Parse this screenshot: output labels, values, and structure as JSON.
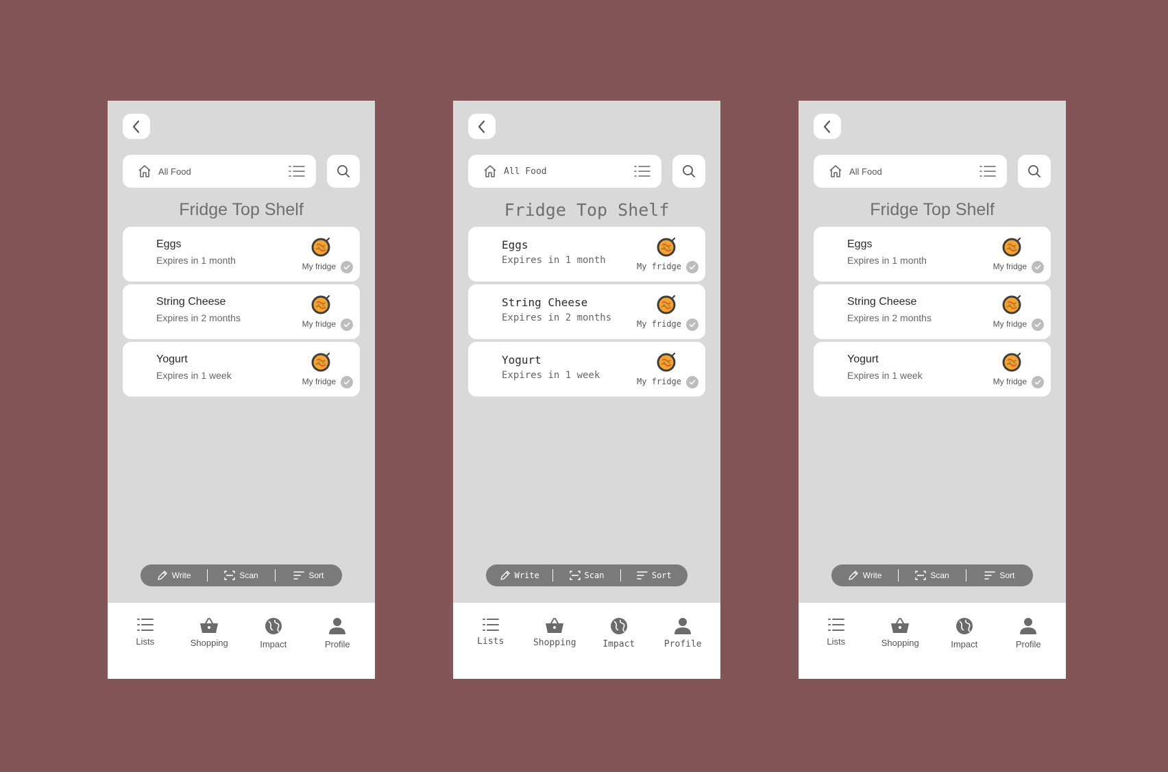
{
  "screens": [
    {
      "variant": "sans",
      "filter_label": "All Food",
      "title": "Fridge Top Shelf",
      "items": [
        {
          "name": "Eggs",
          "expiry": "Expires in 1 month",
          "location": "My fridge"
        },
        {
          "name": "String Cheese",
          "expiry": "Expires in 2 months",
          "location": "My fridge"
        },
        {
          "name": "Yogurt",
          "expiry": "Expires in 1 week",
          "location": "My fridge"
        }
      ],
      "toolbar": {
        "write": "Write",
        "scan": "Scan",
        "sort": "Sort"
      },
      "nav": {
        "lists": "Lists",
        "shopping": "Shopping",
        "impact": "Impact",
        "profile": "Profile"
      }
    },
    {
      "variant": "mono",
      "filter_label": "All Food",
      "title": "Fridge Top Shelf",
      "items": [
        {
          "name": "Eggs",
          "expiry": "Expires in 1 month",
          "location": "My fridge"
        },
        {
          "name": "String Cheese",
          "expiry": "Expires in 2 months",
          "location": "My fridge"
        },
        {
          "name": "Yogurt",
          "expiry": "Expires in 1 week",
          "location": "My fridge"
        }
      ],
      "toolbar": {
        "write": "Write",
        "scan": "Scan",
        "sort": "Sort"
      },
      "nav": {
        "lists": "Lists",
        "shopping": "Shopping",
        "impact": "Impact",
        "profile": "Profile"
      }
    },
    {
      "variant": "sans",
      "filter_label": "All Food",
      "title": "Fridge Top Shelf",
      "items": [
        {
          "name": "Eggs",
          "expiry": "Expires in 1 month",
          "location": "My fridge"
        },
        {
          "name": "String Cheese",
          "expiry": "Expires in 2 months",
          "location": "My fridge"
        },
        {
          "name": "Yogurt",
          "expiry": "Expires in 1 week",
          "location": "My fridge"
        }
      ],
      "toolbar": {
        "write": "Write",
        "scan": "Scan",
        "sort": "Sort"
      },
      "nav": {
        "lists": "Lists",
        "shopping": "Shopping",
        "impact": "Impact",
        "profile": "Profile"
      }
    }
  ],
  "colors": {
    "background": "#845557",
    "screen": "#d9d9d9",
    "card": "#ffffff",
    "toolbar": "#7a7a7a",
    "icon": "#6b6b6b"
  },
  "icons": {
    "back": "chevron-left-icon",
    "filter": "home-icon",
    "list": "list-icon",
    "search": "search-icon",
    "dish": "food-dish-icon",
    "check": "check-circle-icon",
    "write": "pencil-icon",
    "scan": "scan-icon",
    "sort": "sort-icon",
    "lists": "list-icon",
    "shopping": "basket-icon",
    "impact": "globe-icon",
    "profile": "person-icon"
  }
}
